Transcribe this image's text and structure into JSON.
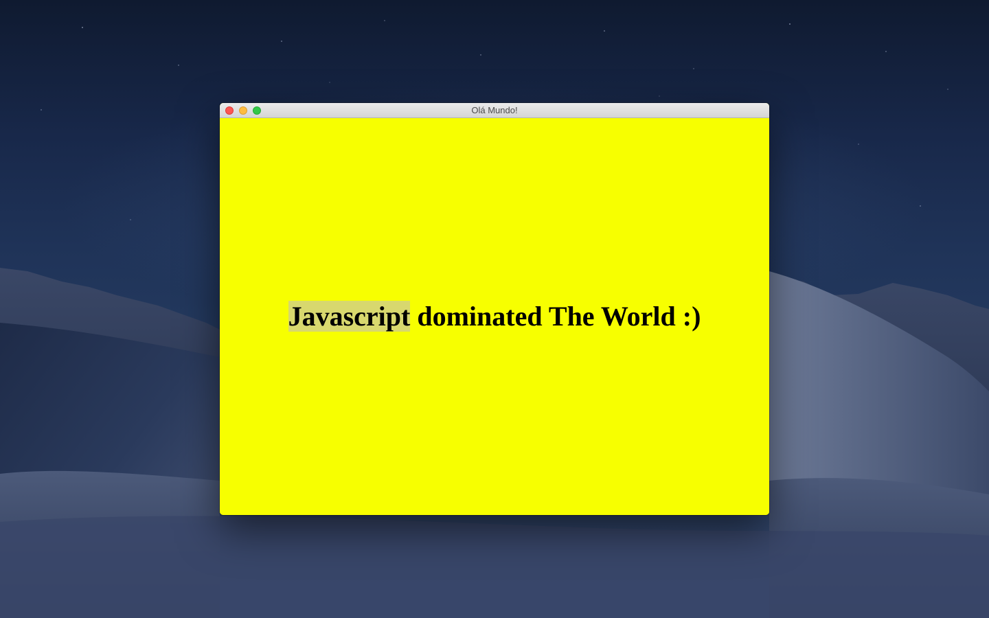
{
  "window": {
    "title": "Olá Mundo!"
  },
  "content": {
    "selected_word": "Javascript",
    "headline_rest": " dominated The World :)"
  },
  "colors": {
    "content_background": "#f7ff00",
    "selection_highlight": "#d8d86e",
    "close_button": "#fc5753",
    "minimize_button": "#fdbc40",
    "zoom_button": "#33c748"
  }
}
